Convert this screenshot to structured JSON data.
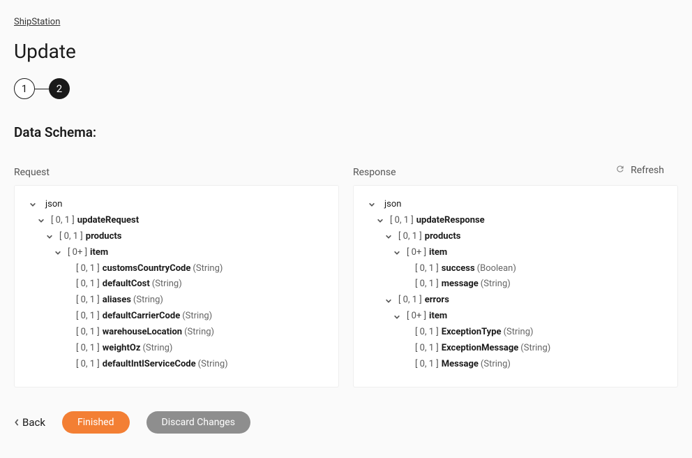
{
  "breadcrumb": "ShipStation",
  "pageTitle": "Update",
  "stepper": {
    "step1": "1",
    "step2": "2"
  },
  "sectionTitle": "Data Schema:",
  "refreshLabel": "Refresh",
  "requestLabel": "Request",
  "responseLabel": "Response",
  "requestTree": [
    {
      "indent": 0,
      "chevron": true,
      "cardinality": "",
      "name": "json",
      "bold": false,
      "type": ""
    },
    {
      "indent": 1,
      "chevron": true,
      "cardinality": "[ 0, 1 ]",
      "name": "updateRequest",
      "bold": true,
      "type": ""
    },
    {
      "indent": 2,
      "chevron": true,
      "cardinality": "[ 0, 1 ]",
      "name": "products",
      "bold": true,
      "type": ""
    },
    {
      "indent": 3,
      "chevron": true,
      "cardinality": "[ 0+ ]",
      "name": "item",
      "bold": true,
      "type": ""
    },
    {
      "indent": 4,
      "chevron": false,
      "cardinality": "[ 0, 1 ]",
      "name": "customsCountryCode",
      "bold": true,
      "type": "(String)"
    },
    {
      "indent": 4,
      "chevron": false,
      "cardinality": "[ 0, 1 ]",
      "name": "defaultCost",
      "bold": true,
      "type": "(String)"
    },
    {
      "indent": 4,
      "chevron": false,
      "cardinality": "[ 0, 1 ]",
      "name": "aliases",
      "bold": true,
      "type": "(String)"
    },
    {
      "indent": 4,
      "chevron": false,
      "cardinality": "[ 0, 1 ]",
      "name": "defaultCarrierCode",
      "bold": true,
      "type": "(String)"
    },
    {
      "indent": 4,
      "chevron": false,
      "cardinality": "[ 0, 1 ]",
      "name": "warehouseLocation",
      "bold": true,
      "type": "(String)"
    },
    {
      "indent": 4,
      "chevron": false,
      "cardinality": "[ 0, 1 ]",
      "name": "weightOz",
      "bold": true,
      "type": "(String)"
    },
    {
      "indent": 4,
      "chevron": false,
      "cardinality": "[ 0, 1 ]",
      "name": "defaultIntlServiceCode",
      "bold": true,
      "type": "(String)"
    }
  ],
  "responseTree": [
    {
      "indent": 0,
      "chevron": true,
      "cardinality": "",
      "name": "json",
      "bold": false,
      "type": ""
    },
    {
      "indent": 1,
      "chevron": true,
      "cardinality": "[ 0, 1 ]",
      "name": "updateResponse",
      "bold": true,
      "type": ""
    },
    {
      "indent": 2,
      "chevron": true,
      "cardinality": "[ 0, 1 ]",
      "name": "products",
      "bold": true,
      "type": ""
    },
    {
      "indent": 3,
      "chevron": true,
      "cardinality": "[ 0+ ]",
      "name": "item",
      "bold": true,
      "type": ""
    },
    {
      "indent": 4,
      "chevron": false,
      "cardinality": "[ 0, 1 ]",
      "name": "success",
      "bold": true,
      "type": "(Boolean)"
    },
    {
      "indent": 4,
      "chevron": false,
      "cardinality": "[ 0, 1 ]",
      "name": "message",
      "bold": true,
      "type": "(String)"
    },
    {
      "indent": 2,
      "chevron": true,
      "cardinality": "[ 0, 1 ]",
      "name": "errors",
      "bold": true,
      "type": ""
    },
    {
      "indent": 3,
      "chevron": true,
      "cardinality": "[ 0+ ]",
      "name": "item",
      "bold": true,
      "type": ""
    },
    {
      "indent": 4,
      "chevron": false,
      "cardinality": "[ 0, 1 ]",
      "name": "ExceptionType",
      "bold": true,
      "type": "(String)"
    },
    {
      "indent": 4,
      "chevron": false,
      "cardinality": "[ 0, 1 ]",
      "name": "ExceptionMessage",
      "bold": true,
      "type": "(String)"
    },
    {
      "indent": 4,
      "chevron": false,
      "cardinality": "[ 0, 1 ]",
      "name": "Message",
      "bold": true,
      "type": "(String)"
    }
  ],
  "footer": {
    "back": "Back",
    "finished": "Finished",
    "discard": "Discard Changes"
  }
}
